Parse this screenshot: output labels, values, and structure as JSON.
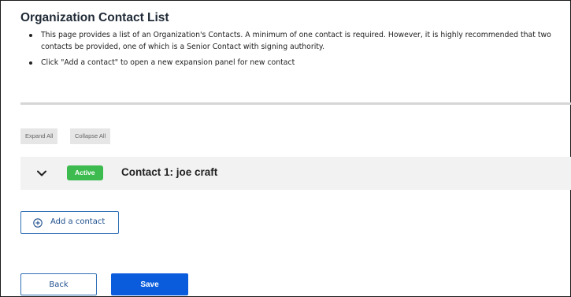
{
  "header": {
    "title": "Organization Contact List"
  },
  "instructions": [
    "This page provides a list of an Organization's Contacts. A minimum of one contact is required. However, it is highly recommended that two contacts be provided, one of which is a Senior Contact with signing authority.",
    "Click \"Add a contact\" to open a new expansion panel for new contact"
  ],
  "toolbar": {
    "expand_all_label": "Expand All",
    "collapse_all_label": "Collapse All"
  },
  "contacts": [
    {
      "status": "Active",
      "status_color": "#3dbb4f",
      "title": "Contact 1: joe craft",
      "icon": "chevron-down-icon"
    }
  ],
  "actions": {
    "add_contact_label": "Add a contact",
    "add_contact_icon": "plus-circle-icon",
    "back_label": "Back",
    "save_label": "Save",
    "primary_color": "#0a5cdc"
  }
}
